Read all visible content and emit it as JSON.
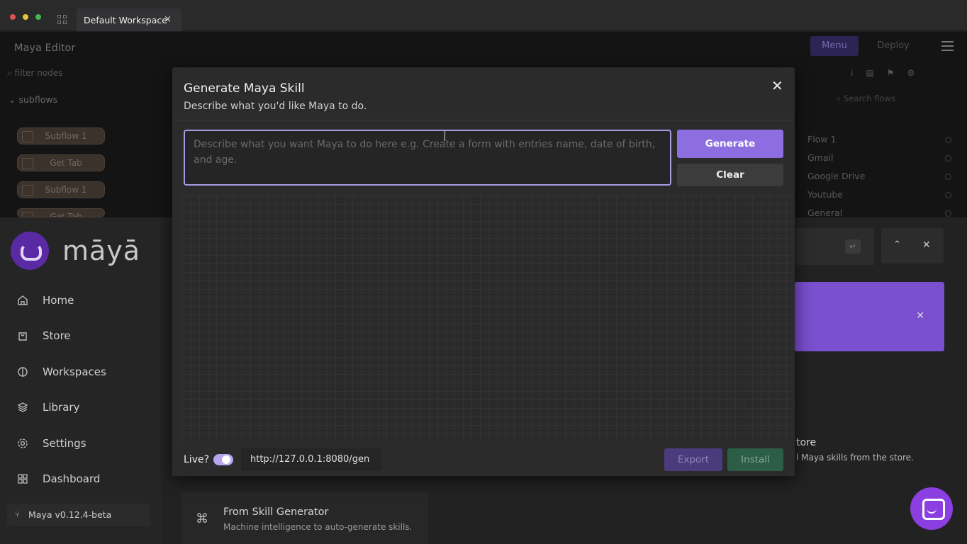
{
  "window": {
    "tab_label": "Default Workspace",
    "tab_close": "×"
  },
  "editor": {
    "title": "Maya Editor",
    "filter_placeholder": "filter nodes",
    "subflows_label": "subflows",
    "nodes": [
      "Subflow 1",
      "Get Tab",
      "Subflow 1",
      "Get Tab"
    ],
    "menu_label": "Menu",
    "deploy_label": "Deploy",
    "search_flows_placeholder": "Search flows",
    "flows": [
      "Flow 1",
      "Gmail",
      "Google Drive",
      "Youtube",
      "General"
    ]
  },
  "app": {
    "logo_text": "māyā",
    "nav": [
      {
        "label": "Home",
        "icon": "home-icon"
      },
      {
        "label": "Store",
        "icon": "bag-icon"
      },
      {
        "label": "Workspaces",
        "icon": "workspaces-icon"
      },
      {
        "label": "Library",
        "icon": "layers-icon"
      },
      {
        "label": "Settings",
        "icon": "gear-icon"
      },
      {
        "label": "Dashboard",
        "icon": "grid-icon"
      }
    ],
    "version": "Maya v0.12.4-beta",
    "store_title": "tore",
    "store_desc": "l Maya skills from the store.",
    "skill_generator_title": "From Skill Generator",
    "skill_generator_desc": "Machine intelligence to auto-generate skills."
  },
  "modal": {
    "title": "Generate Maya Skill",
    "subtitle": "Describe what you'd like Maya to do.",
    "prompt_placeholder": "Describe what you want Maya to do here e.g. Create a form with entries name, date of birth, and age.",
    "generate_label": "Generate",
    "clear_label": "Clear",
    "live_label": "Live?",
    "live_enabled": true,
    "url": "http://127.0.0.1:8080/gen",
    "export_label": "Export",
    "install_label": "Install"
  },
  "colors": {
    "accent": "#8d6ee0",
    "install": "#2b5e45",
    "chat": "#8b3fe0"
  }
}
